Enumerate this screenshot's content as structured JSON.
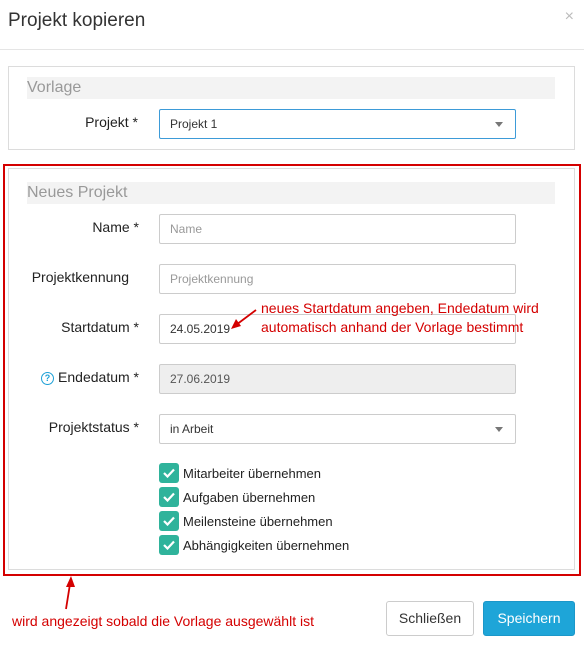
{
  "dialog": {
    "title": "Projekt kopieren",
    "close_glyph": "×"
  },
  "vorlage": {
    "section_title": "Vorlage",
    "projekt_label": "Projekt *",
    "projekt_value": "Projekt 1"
  },
  "neu": {
    "section_title": "Neues Projekt",
    "name_label": "Name *",
    "name_placeholder": "Name",
    "kennung_label": "Projektkennung",
    "kennung_placeholder": "Projektkennung",
    "start_label": "Startdatum *",
    "start_value": "24.05.2019",
    "ende_label": "Endedatum *",
    "ende_value": "27.06.2019",
    "status_label": "Projektstatus *",
    "status_value": "in Arbeit",
    "checkboxes": [
      {
        "label": "Mitarbeiter übernehmen",
        "checked": true
      },
      {
        "label": "Aufgaben übernehmen",
        "checked": true
      },
      {
        "label": "Meilensteine übernehmen",
        "checked": true
      },
      {
        "label": "Abhängigkeiten übernehmen",
        "checked": true
      }
    ]
  },
  "annotations": {
    "start_line1": "neues Startdatum angeben, Endedatum wird",
    "start_line2": "automatisch anhand der Vorlage bestimmt",
    "bottom": "wird angezeigt sobald die Vorlage ausgewählt ist",
    "color": "#d40000"
  },
  "footer": {
    "close_label": "Schließen",
    "save_label": "Speichern"
  },
  "colors": {
    "accent": "#1ea5d8",
    "check": "#2fb39b"
  }
}
